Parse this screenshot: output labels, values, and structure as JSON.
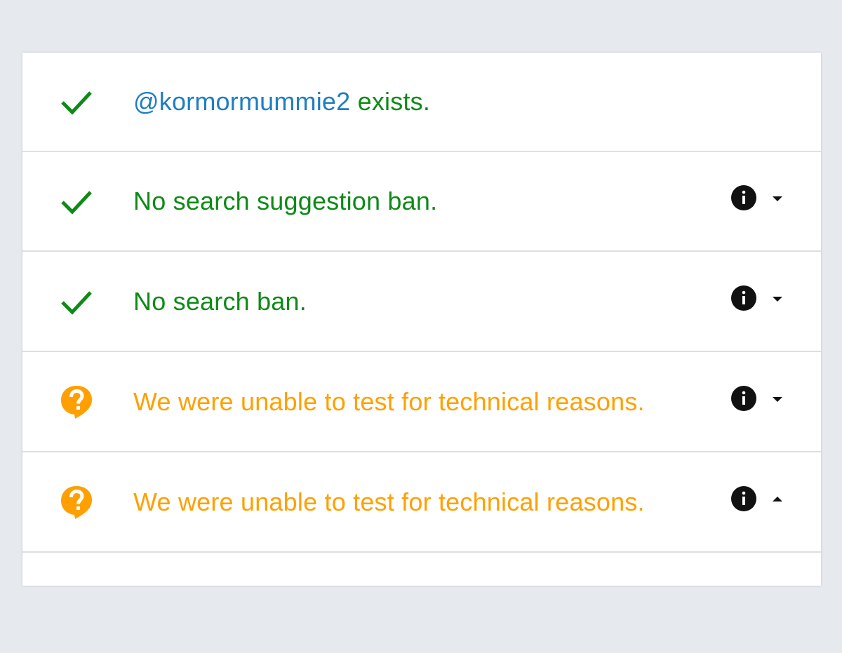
{
  "results": [
    {
      "status": "ok",
      "icon": "checkmark-icon",
      "handle": "@kormormummie2",
      "text": " exists.",
      "has_info": false
    },
    {
      "status": "ok",
      "icon": "checkmark-icon",
      "text": "No search suggestion ban.",
      "has_info": true,
      "expanded": false
    },
    {
      "status": "ok",
      "icon": "checkmark-icon",
      "text": "No search ban.",
      "has_info": true,
      "expanded": false
    },
    {
      "status": "unknown",
      "icon": "question-bubble-icon",
      "text": "We were unable to test for technical reasons.",
      "has_info": true,
      "expanded": false
    },
    {
      "status": "unknown",
      "icon": "question-bubble-icon",
      "text": "We were unable to test for technical reasons.",
      "has_info": true,
      "expanded": true
    }
  ],
  "colors": {
    "ok": "#0e8a16",
    "unknown": "#ffa000",
    "handle": "#1f7ec2",
    "background": "#e6eaee"
  }
}
